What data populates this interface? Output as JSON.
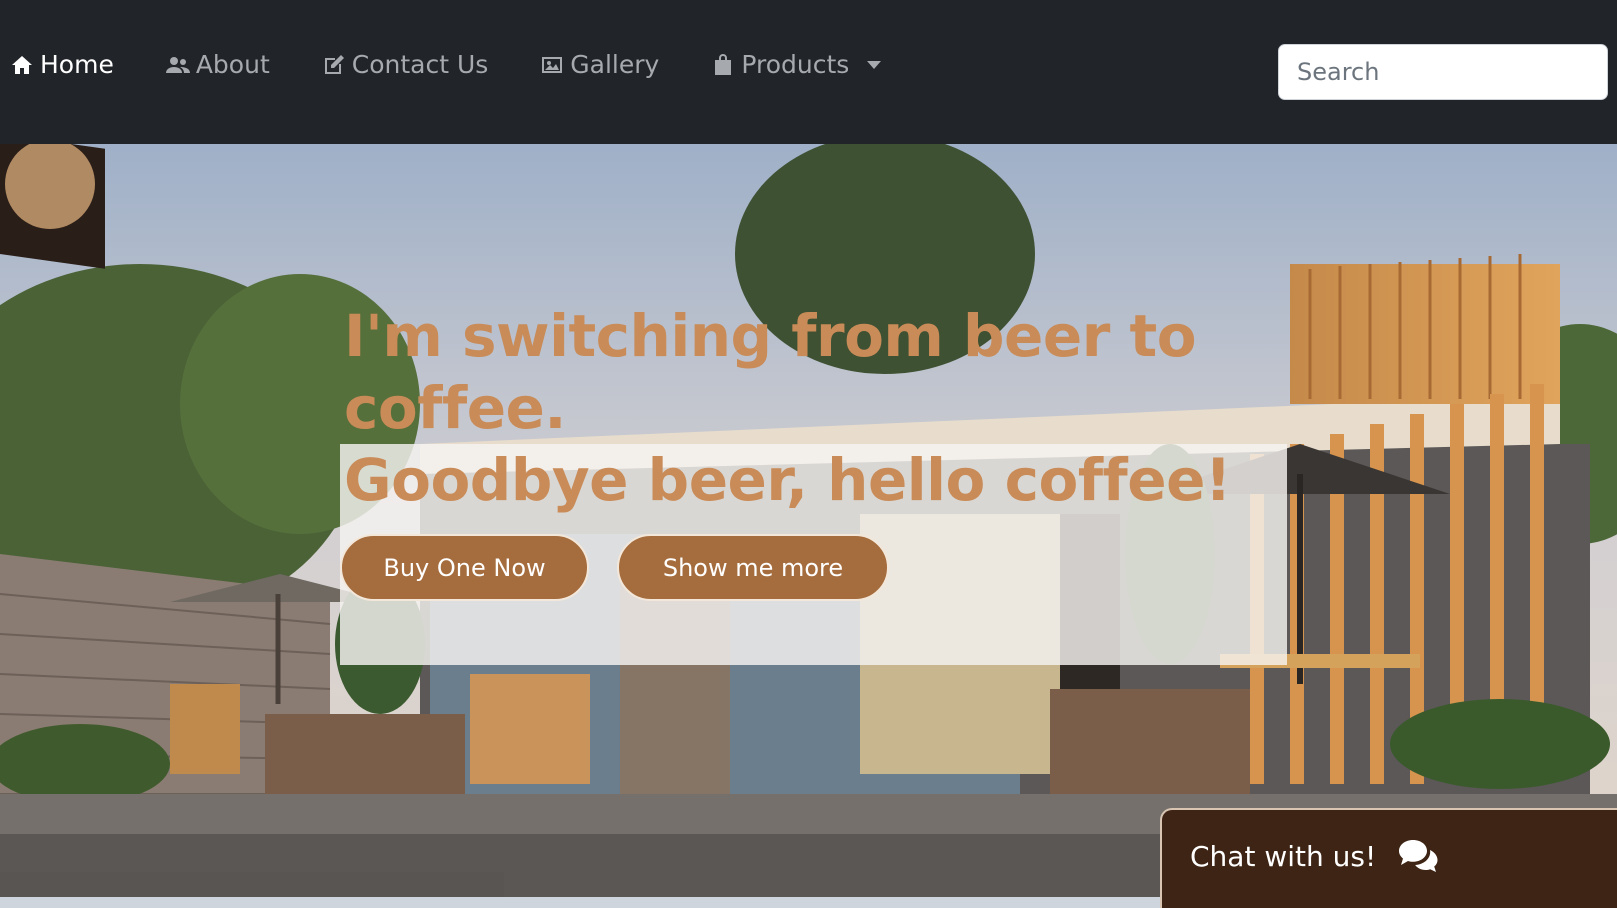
{
  "nav": {
    "items": [
      {
        "label": "Home",
        "icon": "home-icon",
        "active": true
      },
      {
        "label": "About",
        "icon": "users-icon",
        "active": false
      },
      {
        "label": "Contact Us",
        "icon": "edit-icon",
        "active": false
      },
      {
        "label": "Gallery",
        "icon": "image-icon",
        "active": false
      },
      {
        "label": "Products",
        "icon": "shopping-bag-icon",
        "active": false,
        "dropdown": true
      }
    ],
    "search_placeholder": "Search"
  },
  "hero": {
    "line1": "I'm switching from beer to",
    "line2": "coffee.",
    "line3": "Goodbye beer, hello coffee!",
    "buy_button": "Buy One Now",
    "more_button": "Show me more"
  },
  "chat": {
    "label": "Chat with us!",
    "icon": "chat-bubbles-icon"
  },
  "colors": {
    "navbar": "#212429",
    "accent": "#a56c3d",
    "headline": "#c98b57",
    "chat_bg": "#3d2414"
  }
}
